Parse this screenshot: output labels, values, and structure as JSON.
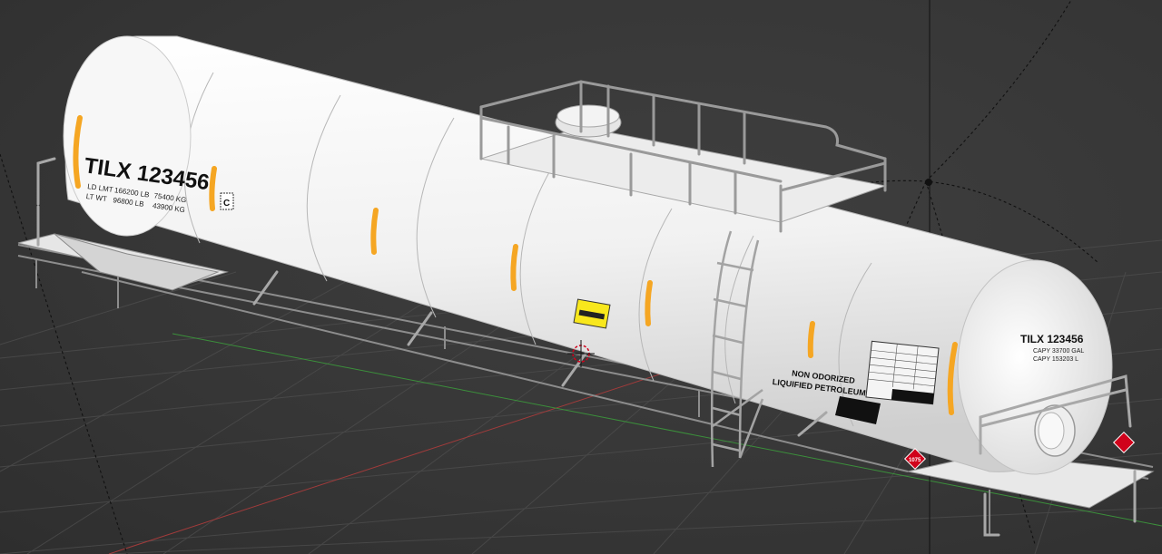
{
  "car": {
    "reporting_mark_side": "TILX 123456",
    "reporting_mark_end": "TILX 123456",
    "ld_lmt_label": "LD LMT",
    "ld_lmt_lb": "166200 LB",
    "ld_lmt_kg": "75400 KG",
    "lt_wt_label": "LT WT",
    "lt_wt_lb": "96800 LB",
    "lt_wt_kg": "43900 KG",
    "capy_gal": "CAPY 33700 GAL",
    "capy_l": "CAPY 153203 L",
    "commodity_line1": "NON ODORIZED",
    "commodity_line2": "LIQUIFIED PETROLEUM GAS",
    "class_badge": "C",
    "placard_number": "1075"
  },
  "colors": {
    "tank": "#f2f2f2",
    "stripe": "#f5a623",
    "placard_red": "#d0021b",
    "warning_yellow": "#f8e71c",
    "grid": "#4a4a4a",
    "axis_x": "#a33b3b",
    "axis_y": "#3b8f3b"
  },
  "icons": {
    "origin": "3d-cursor-icon",
    "pivot": "pivot-point-icon"
  }
}
